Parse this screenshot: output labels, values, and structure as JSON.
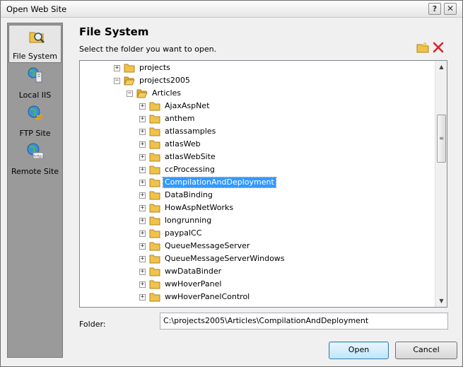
{
  "window": {
    "title": "Open Web Site",
    "help_glyph": "?",
    "close_glyph": "✕"
  },
  "sidebar": {
    "items": [
      {
        "label": "File System",
        "icon": "folder-magnifier-icon",
        "active": true
      },
      {
        "label": "Local IIS",
        "icon": "globe-server-icon",
        "active": false
      },
      {
        "label": "FTP Site",
        "icon": "globe-arrows-icon",
        "active": false
      },
      {
        "label": "Remote Site",
        "icon": "globe-http-icon",
        "active": false
      }
    ]
  },
  "main": {
    "heading": "File System",
    "instruction": "Select the folder you want to open."
  },
  "tree": {
    "expand_glyph": "+",
    "collapse_glyph": "−",
    "nodes": [
      {
        "label": "projects",
        "expander": "+"
      },
      {
        "label": "projects2005",
        "expander": "−"
      },
      {
        "label": "Articles",
        "expander": "−"
      },
      {
        "label": "AjaxAspNet",
        "expander": "+"
      },
      {
        "label": "anthem",
        "expander": "+"
      },
      {
        "label": "atlassamples",
        "expander": "+"
      },
      {
        "label": "atlasWeb",
        "expander": "+"
      },
      {
        "label": "atlasWebSite",
        "expander": "+"
      },
      {
        "label": "ccProcessing",
        "expander": "+"
      },
      {
        "label": "CompilationAndDeployment",
        "expander": "+",
        "selected": true
      },
      {
        "label": "DataBinding",
        "expander": "+"
      },
      {
        "label": "HowAspNetWorks",
        "expander": "+"
      },
      {
        "label": "longrunning",
        "expander": "+"
      },
      {
        "label": "paypalCC",
        "expander": "+"
      },
      {
        "label": "QueueMessageServer",
        "expander": "+"
      },
      {
        "label": "QueueMessageServerWindows",
        "expander": "+"
      },
      {
        "label": "wwDataBinder",
        "expander": "+"
      },
      {
        "label": "wwHoverPanel",
        "expander": "+"
      },
      {
        "label": "wwHoverPanelControl",
        "expander": "+"
      }
    ]
  },
  "scrollbar": {
    "up": "▲",
    "down": "▼",
    "grip": "≡"
  },
  "folder": {
    "label": "Folder:",
    "value": "C:\\projects2005\\Articles\\CompilationAndDeployment"
  },
  "buttons": {
    "open": "Open",
    "cancel": "Cancel"
  },
  "colors": {
    "selection": "#3399ff",
    "folder": "#e8b83a",
    "delete": "#d9262b"
  }
}
